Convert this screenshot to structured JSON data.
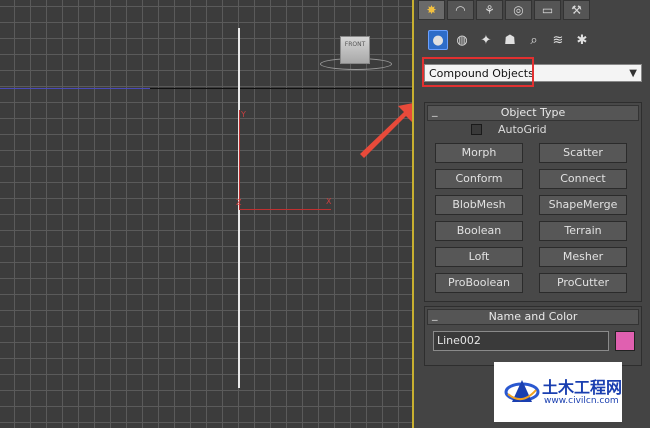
{
  "viewport": {
    "viewcube_label": "FRONT",
    "gizmo_x_label": "X",
    "gizmo_y_label": "Y",
    "gizmo_z_label": "Z"
  },
  "command_panel": {
    "tabs": [
      {
        "icon": "create-icon",
        "glyph": "✸",
        "active": true
      },
      {
        "icon": "modify-icon",
        "glyph": "◠",
        "active": false
      },
      {
        "icon": "hierarchy-icon",
        "glyph": "⚘",
        "active": false
      },
      {
        "icon": "motion-icon",
        "glyph": "◎",
        "active": false
      },
      {
        "icon": "display-icon",
        "glyph": "▭",
        "active": false
      },
      {
        "icon": "utilities-icon",
        "glyph": "⚒",
        "active": false
      }
    ],
    "categories": [
      {
        "icon": "geometry-icon",
        "glyph": "●",
        "active": true
      },
      {
        "icon": "shapes-icon",
        "glyph": "◍",
        "active": false
      },
      {
        "icon": "lights-icon",
        "glyph": "✦",
        "active": false
      },
      {
        "icon": "cameras-icon",
        "glyph": "☗",
        "active": false
      },
      {
        "icon": "helpers-icon",
        "glyph": "⌕",
        "active": false
      },
      {
        "icon": "spacewarps-icon",
        "glyph": "≋",
        "active": false
      },
      {
        "icon": "systems-icon",
        "glyph": "✱",
        "active": false
      }
    ],
    "type_dropdown": {
      "selected": "Compound Objects"
    },
    "object_type": {
      "title": "Object Type",
      "toggle": "_",
      "autogrid_label": "AutoGrid",
      "buttons": [
        "Morph",
        "Scatter",
        "Conform",
        "Connect",
        "BlobMesh",
        "ShapeMerge",
        "Boolean",
        "Terrain",
        "Loft",
        "Mesher",
        "ProBoolean",
        "ProCutter"
      ]
    },
    "name_and_color": {
      "title": "Name and Color",
      "toggle": "_",
      "name_value": "Line002",
      "swatch_color": "#e060b0"
    }
  },
  "colors": {
    "highlight": "#e23030",
    "accent_border": "#c8b030",
    "active_category": "#2d6cc8"
  },
  "watermark": {
    "text_cn": "土木工程网",
    "url": "www.civilcn.com"
  }
}
